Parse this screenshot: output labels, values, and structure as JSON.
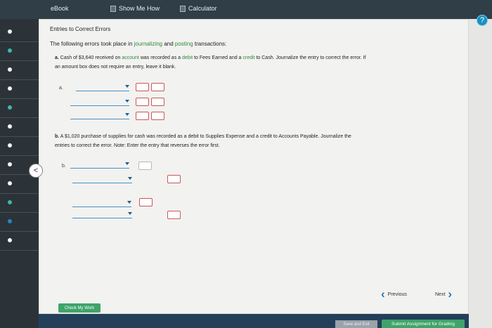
{
  "toolbar": {
    "ebook_label": "eBook",
    "show_me_how_label": "Show Me How",
    "calculator_label": "Calculator",
    "help_label": "?"
  },
  "main": {
    "title": "Entries to Correct Errors",
    "intro_prefix": "The following errors took place in ",
    "intro_link_1": "journalizing",
    "intro_and": " and ",
    "intro_link_2": "posting",
    "intro_suffix": " transactions:",
    "part_a": {
      "marker": "a.",
      "text_1": " Cash of $3,640 received on ",
      "link_account": "account",
      "text_2": " was recorded as a ",
      "link_debit": "debit",
      "text_3": " to Fees Earned and a ",
      "link_credit": "credit",
      "text_4": " to Cash. Journalize the entry to correct the error. If",
      "line_2": "an amount box does not require an entry, leave it blank.",
      "row_label": "a."
    },
    "part_b": {
      "marker": "b.",
      "line_1": " A $1,020 purchase of supplies for cash was recorded as a debit to Supplies Expense and a credit to Accounts Payable. Journalize the",
      "line_2": "entries to correct the error. Note: Enter the entry that reverses the error first.",
      "row_label": "b."
    }
  },
  "buttons": {
    "check_my_work": "Check My Work",
    "previous": "Previous",
    "next": "Next",
    "save_and_exit": "Save and Exit",
    "submit": "Submit Assignment for Grading",
    "back_symbol": "<"
  },
  "colors": {
    "link_green": "#2c8a3a",
    "accent_blue": "#2179b6",
    "action_green": "#3fa46a",
    "error_red": "#cc5555"
  }
}
